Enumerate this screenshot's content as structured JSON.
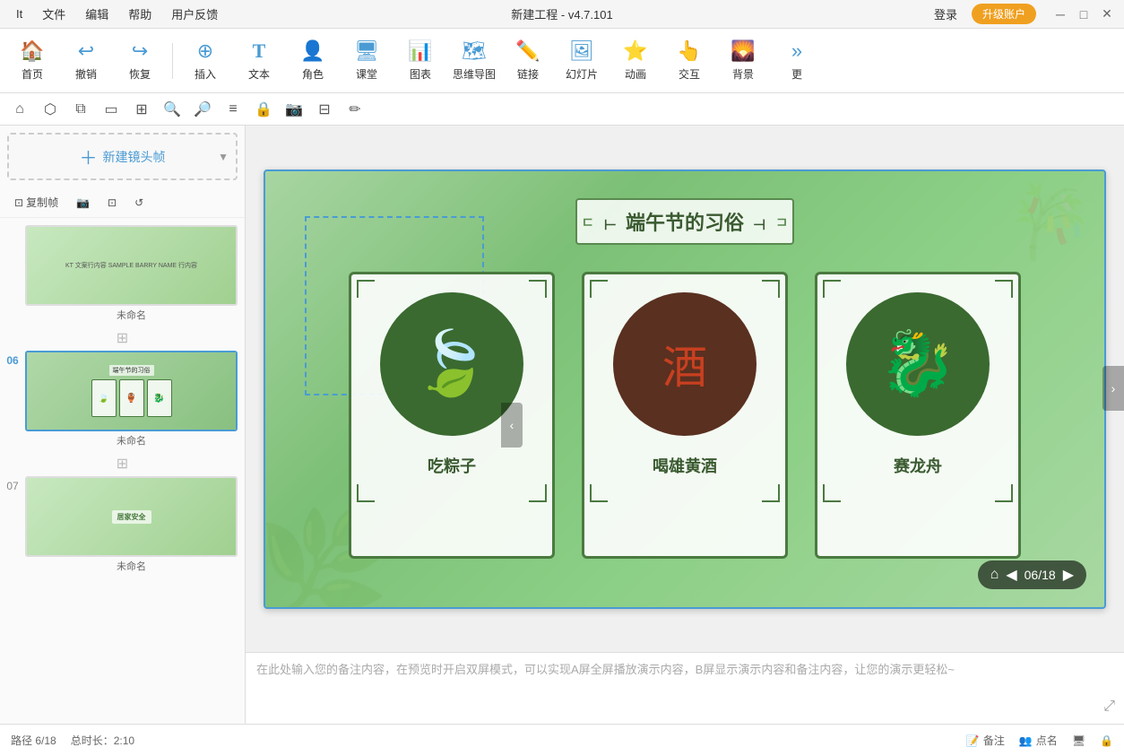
{
  "app": {
    "title": "新建工程 - v4.7.101",
    "menu": [
      "It",
      "文件",
      "编辑",
      "帮助",
      "用户反馈"
    ],
    "login_label": "登录",
    "upgrade_label": "升级账户"
  },
  "toolbar": {
    "items": [
      {
        "id": "home",
        "label": "首页",
        "icon": "🏠"
      },
      {
        "id": "undo",
        "label": "撤销",
        "icon": "↩"
      },
      {
        "id": "redo",
        "label": "恢复",
        "icon": "↪"
      },
      {
        "id": "insert",
        "label": "插入",
        "icon": "⊕"
      },
      {
        "id": "text",
        "label": "文本",
        "icon": "T"
      },
      {
        "id": "role",
        "label": "角色",
        "icon": "👤"
      },
      {
        "id": "class",
        "label": "课堂",
        "icon": "🖥"
      },
      {
        "id": "chart",
        "label": "图表",
        "icon": "📊"
      },
      {
        "id": "mindmap",
        "label": "思维导图",
        "icon": "🗺"
      },
      {
        "id": "link",
        "label": "链接",
        "icon": "🔗"
      },
      {
        "id": "slide",
        "label": "幻灯片",
        "icon": "🖼"
      },
      {
        "id": "animate",
        "label": "动画",
        "icon": "⭐"
      },
      {
        "id": "interact",
        "label": "交互",
        "icon": "👆"
      },
      {
        "id": "bg",
        "label": "背景",
        "icon": "🌄"
      },
      {
        "id": "more",
        "label": "更",
        "icon": "»"
      }
    ]
  },
  "left_panel": {
    "new_frame_label": "新建镜头帧",
    "actions": [
      "复制帧",
      "📷",
      "⊡",
      "↺"
    ],
    "slides": [
      {
        "number": "",
        "label": "未命名",
        "type": "thumb5"
      },
      {
        "number": "06",
        "label": "未命名",
        "type": "thumb6",
        "active": true
      },
      {
        "number": "07",
        "label": "未命名",
        "type": "thumb7"
      }
    ]
  },
  "slide": {
    "title": "端午节的习俗",
    "cards": [
      {
        "id": "zongzi",
        "label": "吃粽子",
        "emoji": "🍃"
      },
      {
        "id": "wine",
        "label": "喝雄黄酒",
        "emoji": "🏺"
      },
      {
        "id": "dragon",
        "label": "赛龙舟",
        "emoji": "🐉"
      }
    ],
    "progress": "06/18"
  },
  "notes": {
    "placeholder": "在此处输入您的备注内容，在预览时开启双屏模式，可以实现A屏全屏播放演示内容，B屏显示演示内容和备注内容，让您的演示更轻松~"
  },
  "status_bar": {
    "path": "路径 6/18",
    "duration": "总时长：2:10",
    "notes_label": "备注",
    "attendance_label": "点名",
    "screen_label": "屏幕",
    "lock_label": "锁定"
  },
  "colors": {
    "accent": "#4a9bd4",
    "green_dark": "#3a6a30",
    "green_mid": "#5a8a50",
    "upgrade_bg": "#f0a020"
  }
}
